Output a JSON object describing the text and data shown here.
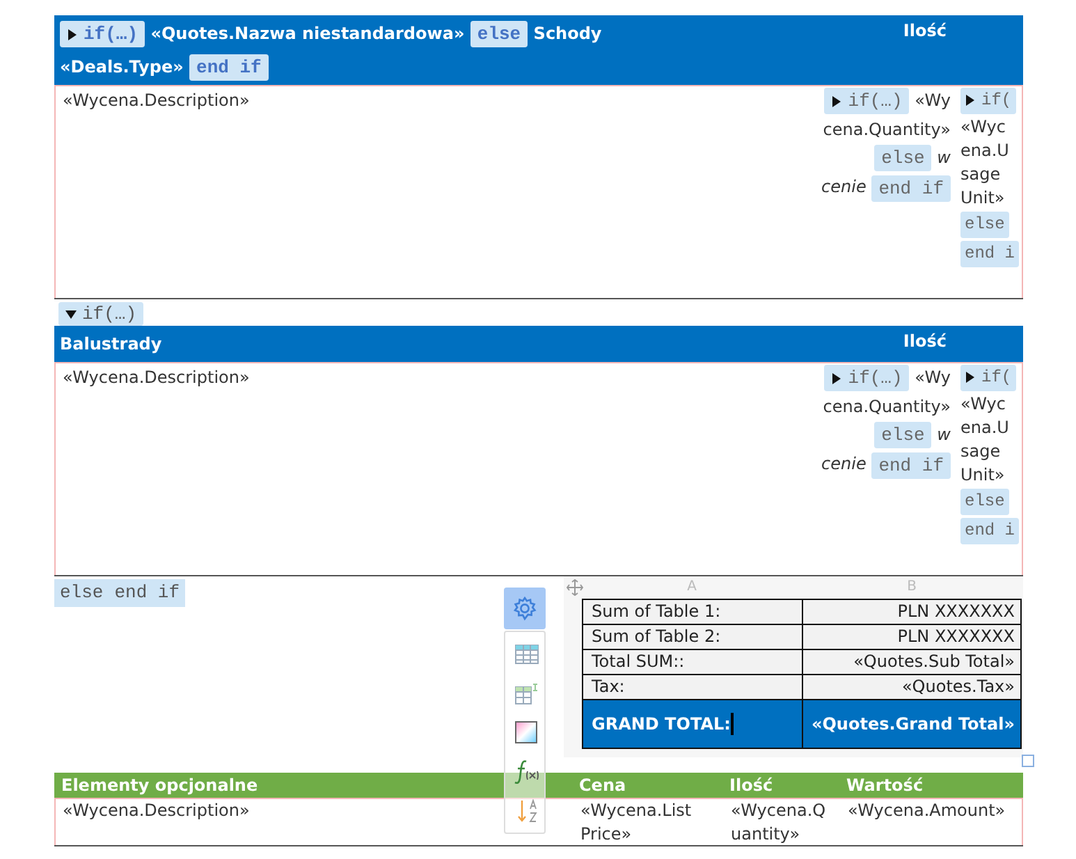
{
  "quote_table": {
    "heading": [
      [
        {
          "kind": "tag",
          "text": "if(…)",
          "expanded": false
        },
        {
          "kind": "field",
          "text": "«Quotes.Nazwa niestandardowa»"
        },
        {
          "kind": "tag",
          "text": "else"
        },
        {
          "kind": "text",
          "text": "Schody"
        }
      ],
      [
        {
          "kind": "field",
          "text": "«Deals.Type»"
        },
        {
          "kind": "tag",
          "text": "end if"
        }
      ]
    ],
    "quantity_heading": "Ilość",
    "description": "«Wycena.Description»",
    "quantity_cell": [
      [
        {
          "kind": "tag",
          "text": "if(…)",
          "expanded": false
        },
        {
          "kind": "text",
          "text": "«Wy"
        }
      ],
      [
        {
          "kind": "text",
          "text": "cena.Quantity»"
        }
      ],
      [
        {
          "kind": "tag",
          "text": "else"
        },
        {
          "kind": "italic",
          "text": "w"
        }
      ],
      [
        {
          "kind": "italic",
          "text": "cenie"
        },
        {
          "kind": "tag",
          "text": "end if"
        }
      ]
    ],
    "unit_cell": [
      [
        {
          "kind": "tag",
          "text": "if(",
          "expanded": false
        }
      ],
      [
        {
          "kind": "text",
          "text": "«Wyc"
        }
      ],
      [
        {
          "kind": "text",
          "text": "ena.U"
        }
      ],
      [
        {
          "kind": "text",
          "text": "sage"
        }
      ],
      [
        {
          "kind": "text",
          "text": "Unit»"
        }
      ],
      [
        {
          "kind": "tag",
          "text": "else"
        }
      ],
      [
        {
          "kind": "tag",
          "text": "end i"
        }
      ]
    ]
  },
  "railing_table": {
    "condition": {
      "text": "if(…)",
      "expanded": true
    },
    "heading": [
      [
        {
          "kind": "text",
          "text": "Balustrady"
        }
      ]
    ],
    "quantity_heading": "Ilość",
    "description": "«Wycena.Description»",
    "quantity_cell": [
      [
        {
          "kind": "tag",
          "text": "if(…)",
          "expanded": false
        },
        {
          "kind": "text",
          "text": "«Wy"
        }
      ],
      [
        {
          "kind": "text",
          "text": "cena.Quantity»"
        }
      ],
      [
        {
          "kind": "tag",
          "text": "else"
        },
        {
          "kind": "italic",
          "text": "w"
        }
      ],
      [
        {
          "kind": "italic",
          "text": "cenie"
        },
        {
          "kind": "tag",
          "text": "end if"
        }
      ]
    ],
    "unit_cell": [
      [
        {
          "kind": "tag",
          "text": "if(",
          "expanded": false
        }
      ],
      [
        {
          "kind": "text",
          "text": "«Wyc"
        }
      ],
      [
        {
          "kind": "text",
          "text": "ena.U"
        }
      ],
      [
        {
          "kind": "text",
          "text": "sage"
        }
      ],
      [
        {
          "kind": "text",
          "text": "Unit»"
        }
      ],
      [
        {
          "kind": "tag",
          "text": "else"
        }
      ],
      [
        {
          "kind": "tag",
          "text": "end i"
        }
      ]
    ]
  },
  "closing_tags": [
    "else",
    "end if"
  ],
  "summary": {
    "columns": [
      "A",
      "B"
    ],
    "rows": [
      {
        "label": "Sum of Table 1:",
        "value": "PLN XXXXXXX",
        "highlighted": false
      },
      {
        "label": "Sum of Table 2:",
        "value": "PLN XXXXXXX",
        "highlighted": false
      },
      {
        "label": "Total SUM::",
        "value": "«Quotes.Sub Total»",
        "highlighted": false
      },
      {
        "label": "Tax:",
        "value": "«Quotes.Tax»",
        "highlighted": false
      },
      {
        "label": "GRAND TOTAL:",
        "value": "«Quotes.Grand Total»",
        "highlighted": true
      }
    ]
  },
  "table_toolbar": [
    {
      "kind": "settings",
      "selected": true
    },
    {
      "kind": "table",
      "selected": false
    },
    {
      "kind": "insert",
      "selected": false
    },
    {
      "kind": "color",
      "selected": false
    },
    {
      "kind": "formula",
      "selected": false
    },
    {
      "kind": "sort",
      "selected": false
    }
  ],
  "optional_items": {
    "columns": [
      "Elementy opcjonalne",
      "Cena",
      "Ilość",
      "Wartość"
    ],
    "row": [
      "«Wycena.Description»",
      "«Wycena.List Price»",
      "«Wycena.Quantity»",
      "«Wycena.Amount»"
    ]
  }
}
